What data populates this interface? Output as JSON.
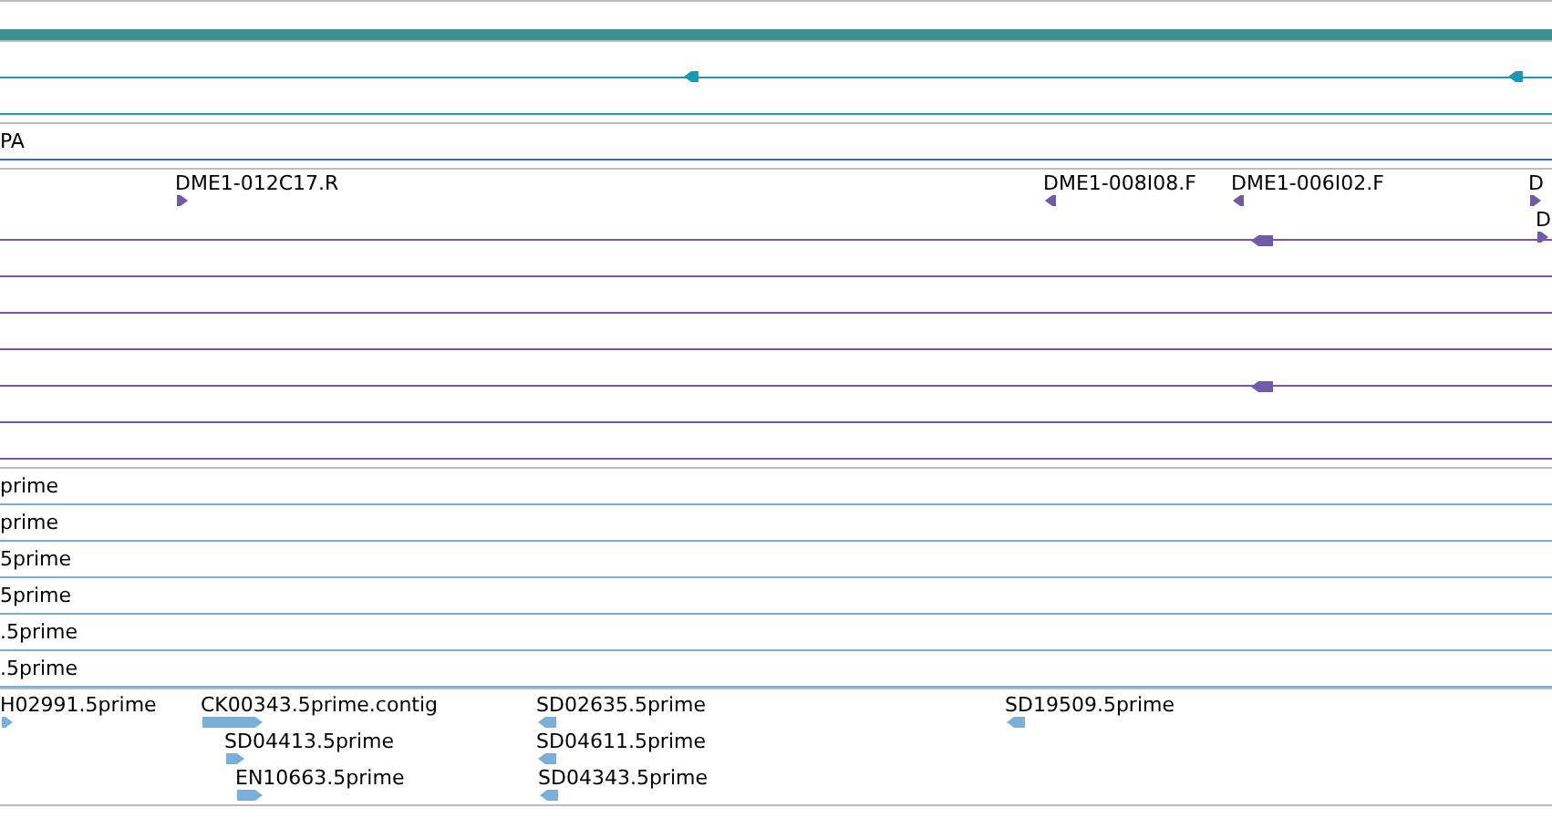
{
  "tracks": [
    {
      "kind": "bar",
      "color": "#3f9090"
    },
    {
      "kind": "lines",
      "color": "#1a97b5",
      "rows": [
        {
          "features": [
            {
              "reverse": true
            },
            {
              "reverse": true
            }
          ]
        },
        {
          "features": []
        }
      ]
    },
    {
      "kind": "text_rows",
      "color": "#3a6bc0",
      "rows": [
        "PA"
      ]
    },
    {
      "kind": "features",
      "color": "#7159a8",
      "features": [
        {
          "label": "DME1-012C17.R",
          "reverse": false
        },
        {
          "label": "DME1-008I08.F",
          "reverse": true
        },
        {
          "label": "DME1-006I02.F",
          "reverse": true
        },
        {
          "label": "D",
          "reverse": false
        },
        {
          "label": "D",
          "reverse": false
        }
      ],
      "lines": [
        {
          "end_marker": true
        },
        {
          "end_marker": false
        },
        {
          "end_marker": false
        },
        {
          "end_marker": false
        },
        {
          "end_marker": true
        },
        {
          "end_marker": false
        },
        {
          "end_marker": false
        }
      ]
    },
    {
      "kind": "text_rows",
      "color": "#7ab0d8",
      "rows": [
        "prime",
        "prime",
        "5prime",
        "5prime",
        ".5prime",
        ".5prime"
      ]
    },
    {
      "kind": "features",
      "color": "#7ab0d8",
      "features": [
        {
          "label": "H02991.5prime",
          "reverse": false
        },
        {
          "label": "CK00343.5prime.contig",
          "reverse": false
        },
        {
          "label": "SD04413.5prime",
          "reverse": false
        },
        {
          "label": "EN10663.5prime",
          "reverse": false
        },
        {
          "label": "SD02635.5prime",
          "reverse": true
        },
        {
          "label": "SD04611.5prime",
          "reverse": true
        },
        {
          "label": "SD04343.5prime",
          "reverse": true
        },
        {
          "label": "SD19509.5prime",
          "reverse": true
        }
      ]
    }
  ]
}
